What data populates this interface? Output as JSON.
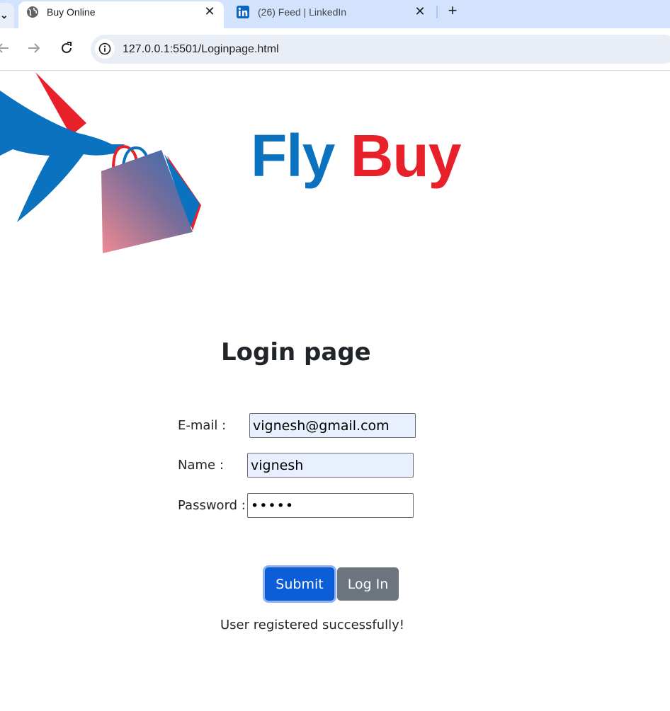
{
  "browser": {
    "tabs": [
      {
        "title": "Buy Online",
        "icon": "globe-icon",
        "active": true
      },
      {
        "title": "(26) Feed | LinkedIn",
        "icon": "linkedin-icon",
        "active": false
      }
    ],
    "new_tab_label": "+",
    "close_glyph": "✕",
    "url": "127.0.0.1:5501/Loginpage.html"
  },
  "brand": {
    "word1": "Fly",
    "word2": "Buy",
    "colors": {
      "fly": "#0b72c0",
      "buy": "#e8202a"
    }
  },
  "login": {
    "title": "Login page",
    "email_label": "E-mail :",
    "email_value": "vignesh@gmail.com",
    "name_label": "Name :",
    "name_value": "vignesh",
    "password_label": "Password :",
    "password_value": "vigne",
    "submit_label": "Submit",
    "login_label": "Log In",
    "status_message": "User registered successfully!"
  },
  "colors": {
    "submit_button": "#0b5ed7",
    "login_button": "#6c757d",
    "autofill_background": "#e8f0fe"
  }
}
